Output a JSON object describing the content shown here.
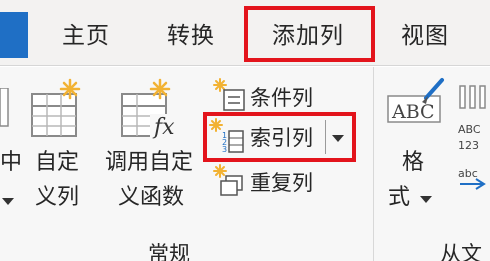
{
  "tabs": {
    "home": "主页",
    "transform": "转换",
    "add_column": "添加列",
    "view": "视图"
  },
  "general_group": {
    "custom_column": [
      "自定",
      "义列"
    ],
    "invoke_custom_function": [
      "调用自定",
      "义函数"
    ],
    "conditional_column": "条件列",
    "index_column": "索引列",
    "duplicate_column": "重复列",
    "group_label": "常规"
  },
  "partial_left_label": [
    "中"
  ],
  "format": {
    "label": [
      "格",
      "式"
    ],
    "abc_text": "ABC",
    "abc_small": "ABC",
    "num_small": "123",
    "abc_lower": "abc"
  },
  "right_group_label_partial": "从文",
  "colors": {
    "highlight": "#e3141c",
    "accent_blue": "#1f6fc5",
    "sparkle": "#f2b233"
  }
}
